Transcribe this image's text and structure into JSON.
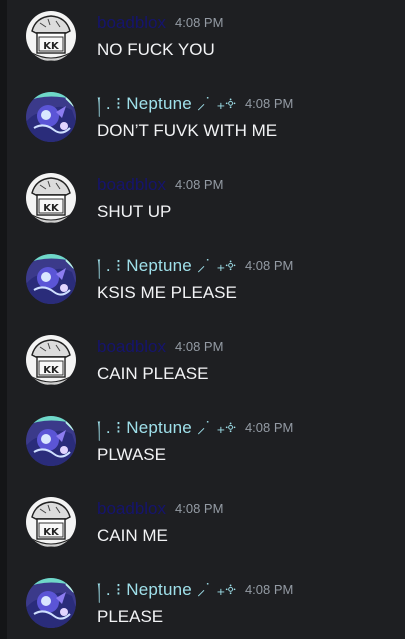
{
  "messages": [
    {
      "author": "boadblox",
      "author_style": "kk",
      "avatar": "kk-hat-avatar",
      "time": "4:08 PM",
      "text": "NO FUCK YOU"
    },
    {
      "author": "།  . ⁝ Neptune ⸝˙ ₊༓",
      "author_style": "nep",
      "avatar": "neptune-avatar",
      "time": "4:08 PM",
      "text": "DON’T FUVK WITH ME"
    },
    {
      "author": "boadblox",
      "author_style": "kk",
      "avatar": "kk-hat-avatar",
      "time": "4:08 PM",
      "text": "SHUT UP"
    },
    {
      "author": "།  . ⁝ Neptune ⸝˙ ₊༓",
      "author_style": "nep",
      "avatar": "neptune-avatar",
      "time": "4:08 PM",
      "text": "KSIS ME PLEASE"
    },
    {
      "author": "boadblox",
      "author_style": "kk",
      "avatar": "kk-hat-avatar",
      "time": "4:08 PM",
      "text": "CAIN PLEASE"
    },
    {
      "author": "།  . ⁝ Neptune ⸝˙ ₊༓",
      "author_style": "nep",
      "avatar": "neptune-avatar",
      "time": "4:08 PM",
      "text": "PLWASE"
    },
    {
      "author": "boadblox",
      "author_style": "kk",
      "avatar": "kk-hat-avatar",
      "time": "4:08 PM",
      "text": "CAIN ME"
    },
    {
      "author": "།  . ⁝ Neptune ⸝˙ ₊༓",
      "author_style": "nep",
      "avatar": "neptune-avatar",
      "time": "4:08 PM",
      "text": "PLEASE"
    }
  ],
  "colors": {
    "background": "#1e1f22",
    "boadblox_name": "#15146c",
    "neptune_name": "#9fe0ea",
    "timestamp": "#949ba4",
    "message_text": "#f2f3f5"
  }
}
